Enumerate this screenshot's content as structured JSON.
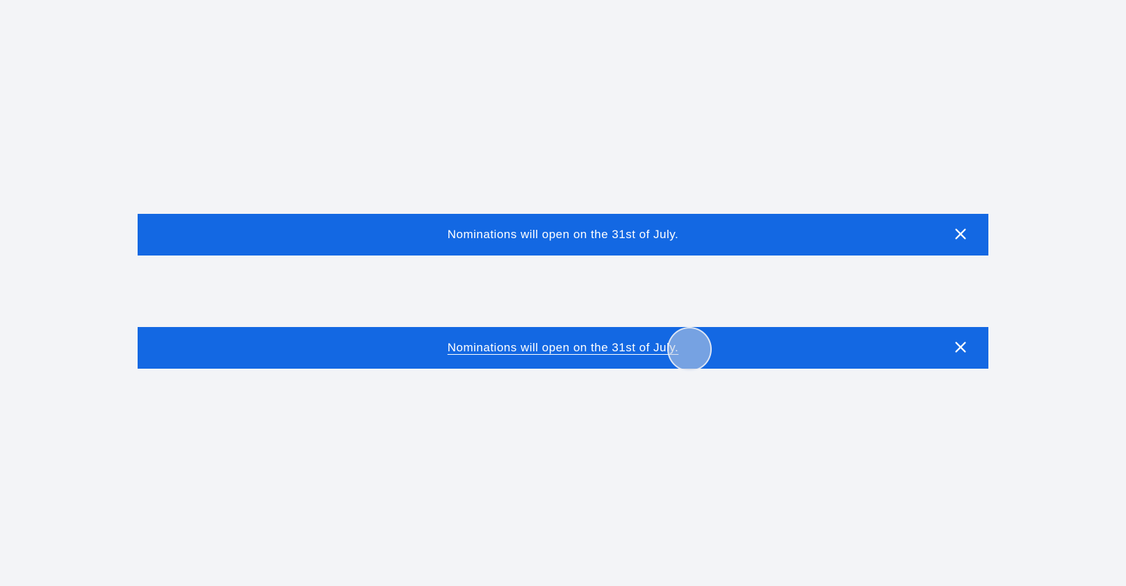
{
  "banners": [
    {
      "message": "Nominations will open on the 31st of July.",
      "underlined": false
    },
    {
      "message": "Nominations will open on the 31st of July.",
      "underlined": true
    }
  ],
  "colors": {
    "banner_bg": "#1368e3",
    "banner_text": "#ffffff",
    "page_bg": "#f3f4f7"
  }
}
